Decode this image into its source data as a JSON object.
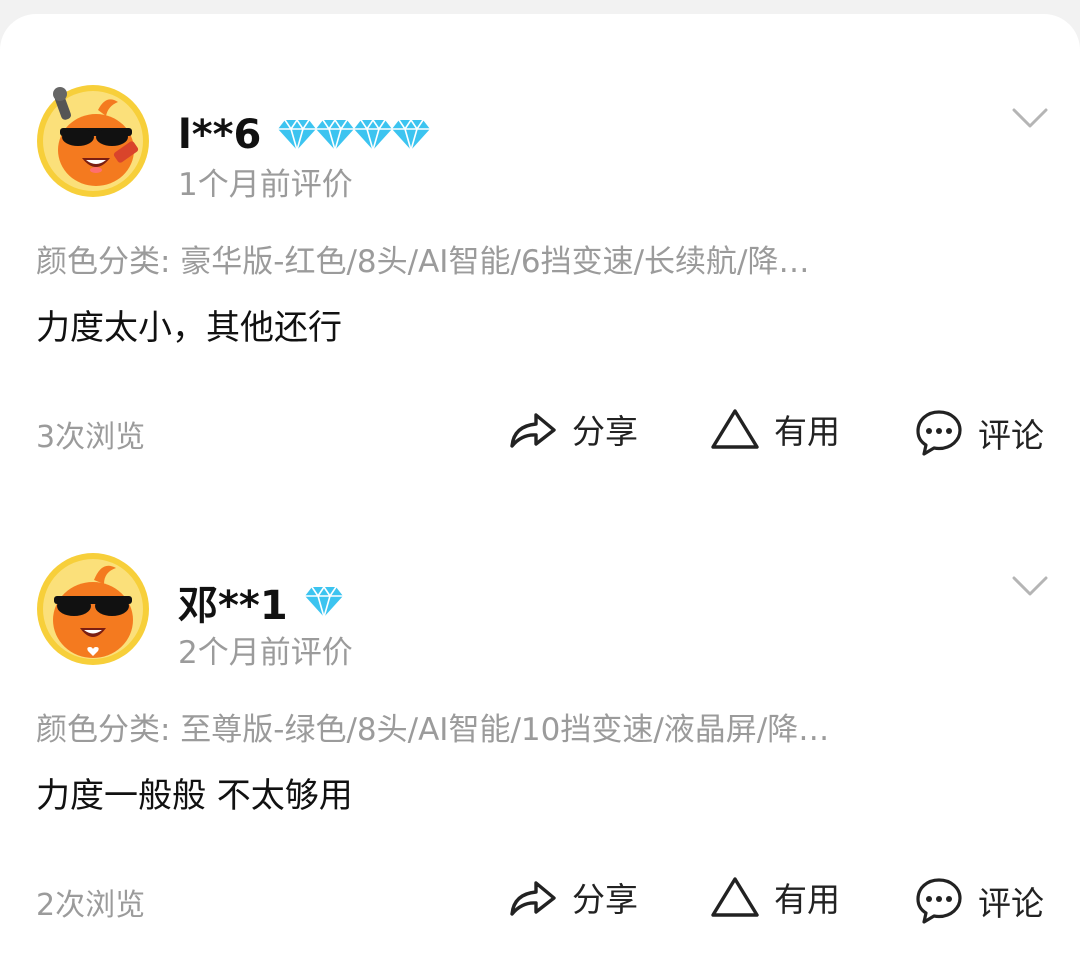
{
  "reviews": [
    {
      "username": "l**6",
      "diamond_count": 4,
      "time": "1个月前评价",
      "sku": "颜色分类: 豪华版-红色/8头/AI智能/6挡变速/长续航/降…",
      "content": "力度太小，其他还行",
      "views": "3次浏览",
      "actions": {
        "share": "分享",
        "useful": "有用",
        "comment": "评论"
      },
      "icons": {
        "avatar": "orange-mascot-microphone-avatar",
        "badge": "diamond-icon",
        "expand": "chevron-down-icon",
        "share": "share-arrow-icon",
        "useful": "triangle-icon",
        "comment": "comment-bubble-icon"
      }
    },
    {
      "username": "邓**1",
      "diamond_count": 1,
      "time": "2个月前评价",
      "sku": "颜色分类: 至尊版-绿色/8头/AI智能/10挡变速/液晶屏/降…",
      "content": "力度一般般 不太够用",
      "views": "2次浏览",
      "actions": {
        "share": "分享",
        "useful": "有用",
        "comment": "评论"
      },
      "icons": {
        "avatar": "orange-mascot-sunglasses-avatar",
        "badge": "diamond-icon",
        "expand": "chevron-down-icon",
        "share": "share-arrow-icon",
        "useful": "triangle-icon",
        "comment": "comment-bubble-icon"
      }
    }
  ],
  "colors": {
    "background": "#f2f2f2",
    "card": "#ffffff",
    "primary_text": "#111111",
    "secondary_text": "#9b9b9b",
    "diamond": "#3cc4f0",
    "avatar_ring": "#f7cf3a",
    "mascot": "#f47a1f"
  }
}
